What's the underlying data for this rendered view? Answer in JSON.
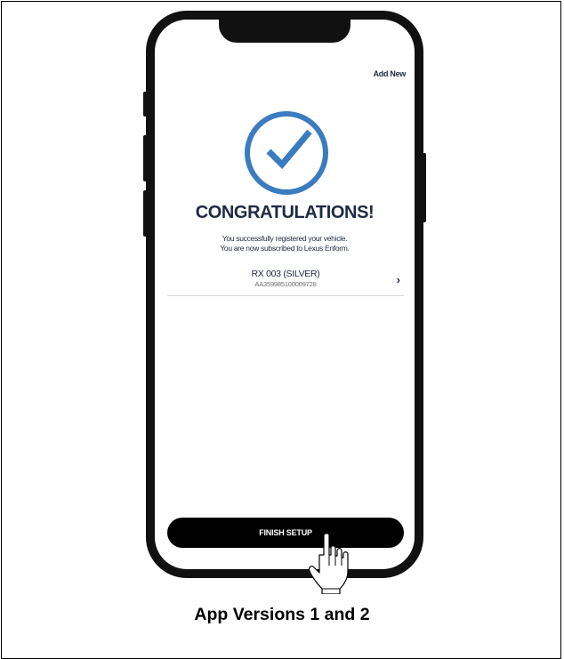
{
  "screen": {
    "add_new_label": "Add New",
    "title": "CONGRATULATIONS!",
    "message_line1": "You successfully registered your vehicle.",
    "message_line2": "You are now subscribed to Lexus Enform.",
    "vehicle": {
      "name": "RX 003 (SILVER)",
      "vin": "AA359985100009728",
      "chevron": "›"
    },
    "finish_label": "FINISH SETUP"
  },
  "caption": "App Versions 1 and 2",
  "colors": {
    "accent_check": "#3a7cbf",
    "text_dark": "#1f2a44",
    "button_bg": "#000000"
  },
  "icons": {
    "success": "checkmark-circle-icon",
    "pointer": "hand-pointer-icon",
    "row_arrow": "chevron-right-icon"
  }
}
